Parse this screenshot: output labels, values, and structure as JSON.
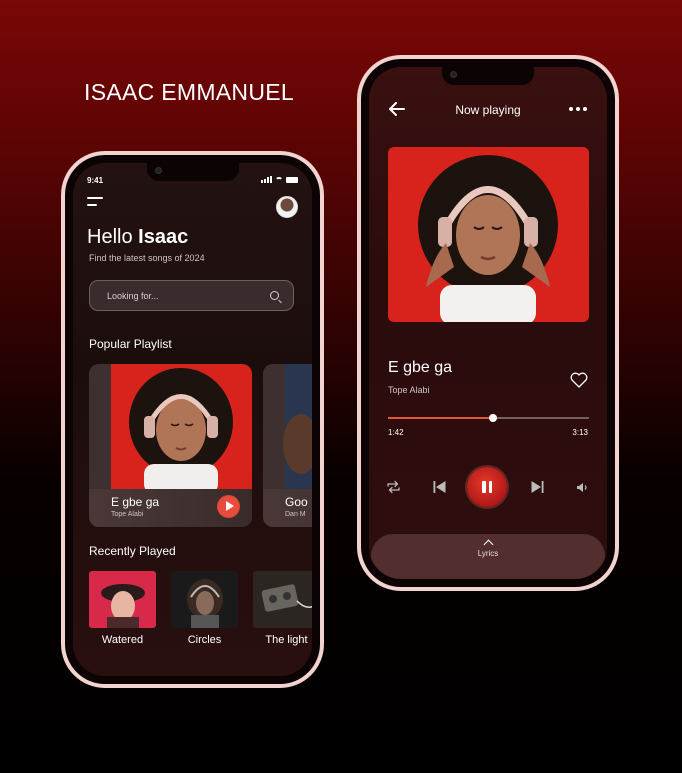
{
  "designer": "ISAAC EMMANUEL",
  "home": {
    "status_time": "9:41",
    "greeting_prefix": "Hello",
    "greeting_name": "Isaac",
    "subtitle": "Find the latest songs of 2024",
    "search_placeholder": "Looking for...",
    "popular_title": "Popular Playlist",
    "popular": [
      {
        "title": "E gbe ga",
        "artist": "Tope Alabi"
      },
      {
        "title": "Goo",
        "artist": "Dan M"
      }
    ],
    "recent_title": "Recently Played",
    "recent": [
      {
        "title": "Watered"
      },
      {
        "title": "Circles"
      },
      {
        "title": "The light"
      }
    ]
  },
  "player": {
    "header_title": "Now playing",
    "song_title": "E gbe ga",
    "artist": "Tope Alabi",
    "elapsed": "1:42",
    "total": "3:13",
    "progress": 0.52,
    "lyrics_label": "Lyrics"
  },
  "colors": {
    "accent": "#e25a34",
    "play_button": "#c82a1c",
    "art_red": "#d7231b"
  }
}
